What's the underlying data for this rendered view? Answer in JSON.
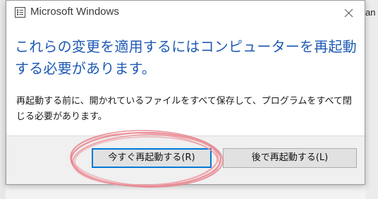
{
  "dialog": {
    "title": "Microsoft Windows",
    "close_icon": "close-icon",
    "main_instruction": "これらの変更を適用するにはコンピューターを再起動する必要があります。",
    "body": "再起動する前に、開かれているファイルをすべて保存して、プログラムをすべて閉じる必要があります。",
    "primary_button": "今すぐ再起動する(R)",
    "secondary_button": "後で再起動する(L)"
  },
  "background": {
    "right_fragment": "an"
  },
  "colors": {
    "instruction_text": "#1f5ab4",
    "focus_border": "#0078d7",
    "annotation_circle": "#e8868f"
  }
}
